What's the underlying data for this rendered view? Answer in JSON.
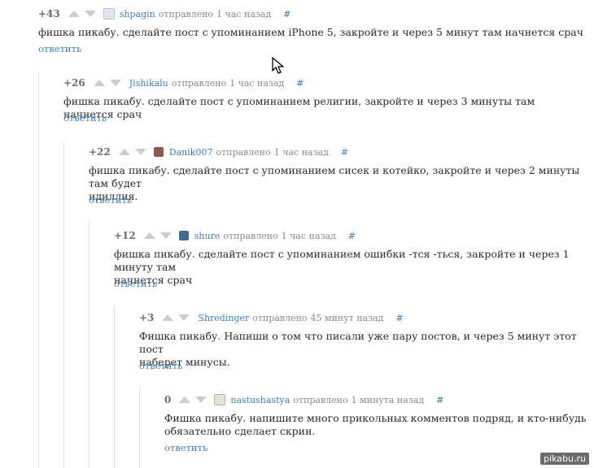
{
  "comments": [
    {
      "score": "+43",
      "user": "shpagin",
      "sent": "отправлено",
      "time": "1 час назад",
      "hash": "#",
      "text": "фишка пикабу. сделайте пост с упоминанием iPhone 5, закройте и через 5 минут там начнется срач",
      "reply": "ответить",
      "avatar": "sketch-avatar-icon",
      "avatar_color": "#dfe8f0"
    },
    {
      "score": "+26",
      "user": "Jishikalu",
      "sent": "отправлено",
      "time": "1 час назад",
      "hash": "#",
      "text": "фишка пикабу. сделайте пост с упоминанием религии, закройте и через 3 минуты там начнется срач",
      "reply": "ответить",
      "avatar": "",
      "avatar_color": ""
    },
    {
      "score": "+22",
      "user": "Danik007",
      "sent": "отправлено",
      "time": "1 час назад",
      "hash": "#",
      "text_line1": "фишка пикабу. сделайте пост с упоминанием сисек и котейко, закройте и через 2 минуты там будет",
      "text_line2": "идиллия.",
      "reply": "ответить",
      "avatar": "photo-avatar-icon",
      "avatar_color": "#8b5a4a"
    },
    {
      "score": "+12",
      "user": "shure",
      "sent": "отправлено",
      "time": "1 час назад",
      "hash": "#",
      "text_line1": "фишка пикабу. сделайте пост с упоминанием ошибки -тся -ться, закройте и через 1 минуту там",
      "text_line2": "начнется срач",
      "reply": "ответить",
      "avatar": "photo-avatar-icon",
      "avatar_color": "#3e6d8e"
    },
    {
      "score": "+3",
      "user": "Shredinger",
      "sent": "отправлено",
      "time": "45 минут назад",
      "hash": "#",
      "text_line1": "Фишка пикабу. Напиши о том что писали уже пару постов, и через 5 минут этот пост",
      "text_line2": "наберет минусы.",
      "reply": "ответить",
      "avatar": "",
      "avatar_color": ""
    },
    {
      "score": "0",
      "user": "nastushastya",
      "sent": "отправлено",
      "time": "1 минута назад",
      "hash": "#",
      "text_line1": "Фишка пикабу. напишите много прикольных комментов подряд, и кто-нибудь",
      "text_line2": "обязательно сделает скрин.",
      "reply": "ответить",
      "avatar": "dog-avatar-icon",
      "avatar_color": "#e7e2d8"
    }
  ],
  "watermark": "pikabu.ru",
  "colors": {
    "link": "#3f7fb7",
    "meta": "#8a8a8a",
    "text": "#2b2b2b",
    "arrow": "#c9ccd1",
    "thread_line": "#e3e3e3"
  }
}
